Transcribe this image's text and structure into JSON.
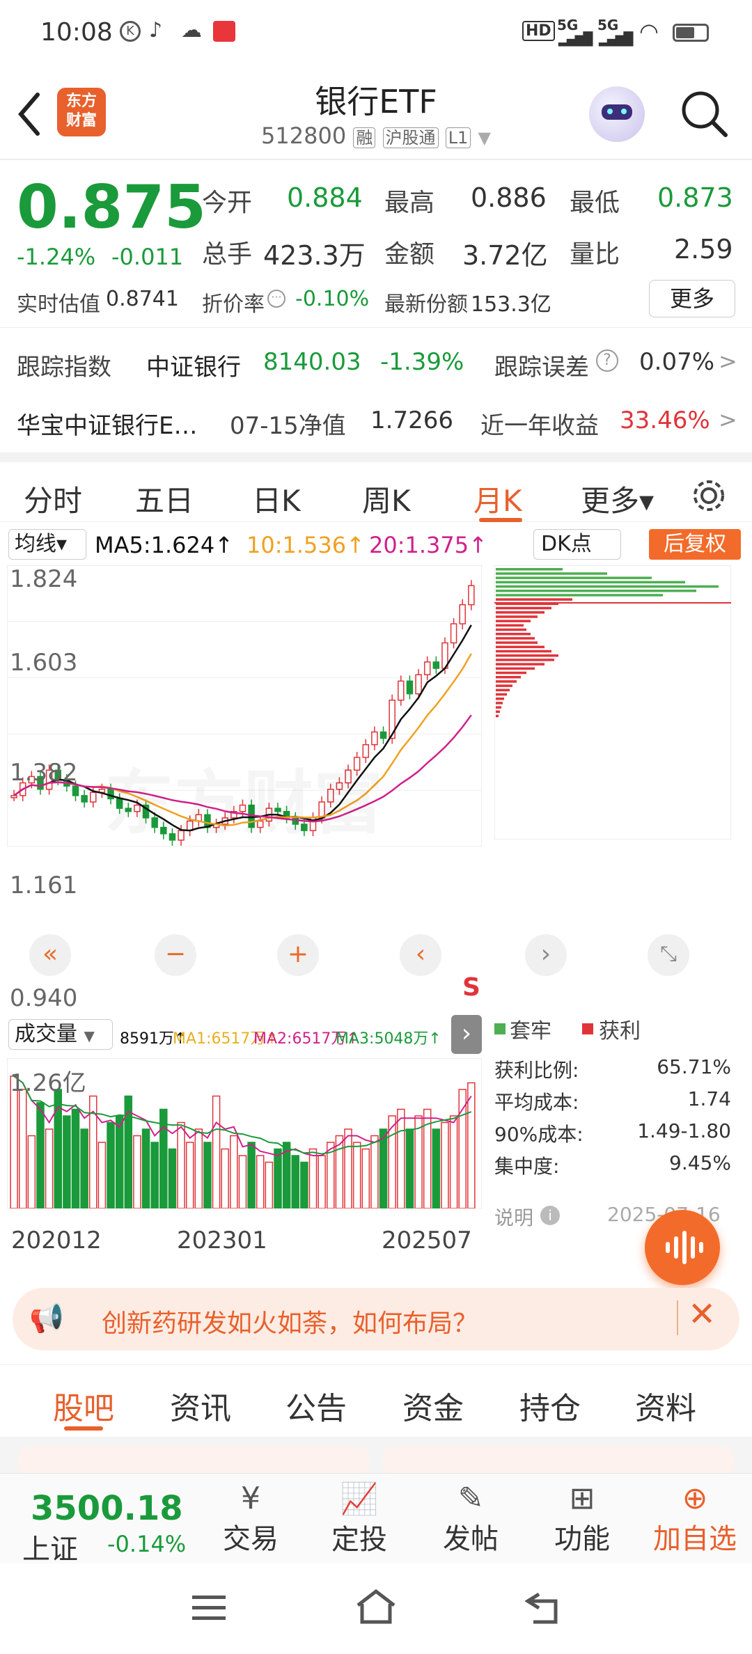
{
  "status": {
    "time": "10:08",
    "network_left": "HD",
    "net1": "5G",
    "net2": "5G"
  },
  "header": {
    "title": "银行ETF",
    "code": "512800",
    "tag1": "融",
    "tag2": "沪股通",
    "tag3": "L1",
    "logo_line1": "东方",
    "logo_line2": "财富"
  },
  "quote": {
    "price": "0.875",
    "change_pct": "-1.24%",
    "change_abs": "-0.011",
    "open_label": "今开",
    "open": "0.884",
    "high_label": "最高",
    "high": "0.886",
    "low_label": "最低",
    "low": "0.873",
    "vol_label": "总手",
    "vol": "423.3万",
    "amt_label": "金额",
    "amt": "3.72亿",
    "ratio_label": "量比",
    "ratio": "2.59",
    "est_label": "实时估值",
    "est": "0.8741",
    "premium_label": "折价率",
    "premium": "-0.10%",
    "shares_label": "最新份额",
    "shares": "153.3亿",
    "more": "更多"
  },
  "tracking": {
    "label": "跟踪指数",
    "index_name": "中证银行",
    "index_value": "8140.03",
    "index_pct": "-1.39%",
    "error_label": "跟踪误差",
    "error_value": "0.07%",
    "arrow": ">"
  },
  "fund": {
    "name": "华宝中证银行E…",
    "nav_label": "07-15净值",
    "nav": "1.7266",
    "ret_label": "近一年收益",
    "ret": "33.46%",
    "arrow": ">"
  },
  "period_tabs": [
    "分时",
    "五日",
    "日K",
    "周K",
    "月K",
    "更多▾"
  ],
  "chart": {
    "ma_selector": "均线▾",
    "ma5": "MA5:1.624↑",
    "ma10": "10:1.536↑",
    "ma20": "20:1.375↑",
    "dk": "DK点",
    "adjust": "后复权",
    "y_labels": [
      "1.824",
      "1.603",
      "1.382",
      "1.161",
      "0.940"
    ],
    "watermark": "东方财富",
    "vol_selector": "成交量",
    "vol_values": "8591万↑",
    "vol_ma1": "MA1:6517万↑",
    "vol_ma2": "MA2:6517万↑",
    "vol_ma3": "MA3:5048万↑",
    "vol_max": "1.26亿",
    "x_labels": [
      "202012",
      "202301",
      "202507"
    ],
    "signal": "S",
    "colors": {
      "up": "#e0343a",
      "down": "#1a9a3a",
      "ma5": "#111111",
      "ma10": "#f0a020",
      "ma20": "#d0208a"
    }
  },
  "chip": {
    "legend_trapped": "套牢",
    "legend_profit": "获利",
    "rows": [
      {
        "label": "获利比例:",
        "value": "65.71%"
      },
      {
        "label": "平均成本:",
        "value": "1.74"
      },
      {
        "label": "90%成本:",
        "value": "1.49-1.80"
      },
      {
        "label": "集中度:",
        "value": "9.45%"
      }
    ],
    "note": "说明",
    "date": "2025-07-16"
  },
  "banner": {
    "text": "创新药研发如火如荼，如何布局？"
  },
  "sub_tabs": [
    "股吧",
    "资讯",
    "公告",
    "资金",
    "持仓",
    "资料"
  ],
  "bottom": {
    "index_value": "3500.18",
    "index_name": "上证",
    "index_pct": "-0.14%",
    "items": [
      "交易",
      "定投",
      "发帖",
      "功能",
      "加自选"
    ]
  }
}
